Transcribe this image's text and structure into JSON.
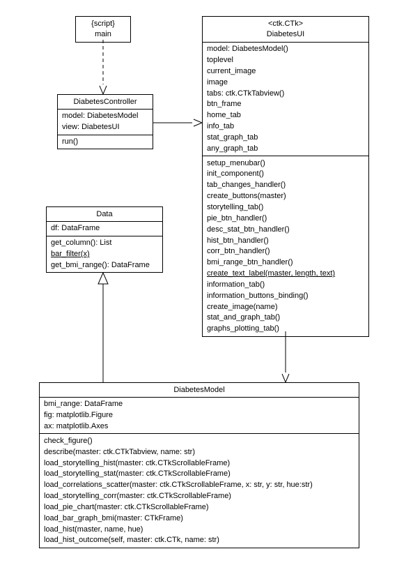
{
  "main": {
    "stereotype": "{script}",
    "name": "main"
  },
  "controller": {
    "name": "DiabetesController",
    "attrs": [
      "model: DiabetesModel",
      "view: DiabetesUI"
    ],
    "methods": [
      "run()"
    ]
  },
  "data": {
    "name": "Data",
    "attrs": [
      "df: DataFrame"
    ],
    "methods": [
      {
        "text": "get_column(): List",
        "underline": false
      },
      {
        "text": "bar_filter(x)",
        "underline": true
      },
      {
        "text": "get_bmi_range(): DataFrame",
        "underline": false
      }
    ]
  },
  "ui": {
    "stereotype": "<ctk.CTk>",
    "name": "DiabetesUI",
    "attrs": [
      "model: DiabetesModel()",
      "toplevel",
      "current_image",
      "image",
      "tabs: ctk.CTkTabview()",
      "btn_frame",
      "home_tab",
      "info_tab",
      "stat_graph_tab",
      "any_graph_tab"
    ],
    "methods": [
      {
        "text": "setup_menubar()",
        "underline": false
      },
      {
        "text": "init_component()",
        "underline": false
      },
      {
        "text": "tab_changes_handler()",
        "underline": false
      },
      {
        "text": "create_buttons(master)",
        "underline": false
      },
      {
        "text": "storytelling_tab()",
        "underline": false
      },
      {
        "text": "pie_btn_handler()",
        "underline": false
      },
      {
        "text": "desc_stat_btn_handler()",
        "underline": false
      },
      {
        "text": "hist_btn_handler()",
        "underline": false
      },
      {
        "text": "corr_btn_handler()",
        "underline": false
      },
      {
        "text": "bmi_range_btn_handler()",
        "underline": false
      },
      {
        "text": "create_text_label(master, length, text)",
        "underline": true
      },
      {
        "text": "information_tab()",
        "underline": false
      },
      {
        "text": "information_buttons_binding()",
        "underline": false
      },
      {
        "text": "create_image(name)",
        "underline": false
      },
      {
        "text": "stat_and_graph_tab()",
        "underline": false
      },
      {
        "text": "graphs_plotting_tab()",
        "underline": false
      }
    ]
  },
  "model": {
    "name": "DiabetesModel",
    "attrs": [
      "bmi_range: DataFrame",
      "fig: matplotlib.Figure",
      "ax: matplotlib.Axes"
    ],
    "methods": [
      "check_figure()",
      "describe(master: ctk.CTkTabview, name: str)",
      "load_storytelling_hist(master: ctk.CTkScrollableFrame)",
      "load_storytelling_stat(master: ctk.CTkScrollableFrame)",
      "load_correlations_scatter(master: ctk.CTkScrollableFrame, x: str, y: str, hue:str)",
      "load_storytelling_corr(master: ctk.CTkScrollableFrame)",
      "load_pie_chart(master: ctk.CTkScrollableFrame)",
      "load_bar_graph_bmi(master: CTkFrame)",
      "load_hist(master, name, hue)",
      "load_hist_outcome(self, master: ctk.CTk, name: str)"
    ]
  }
}
